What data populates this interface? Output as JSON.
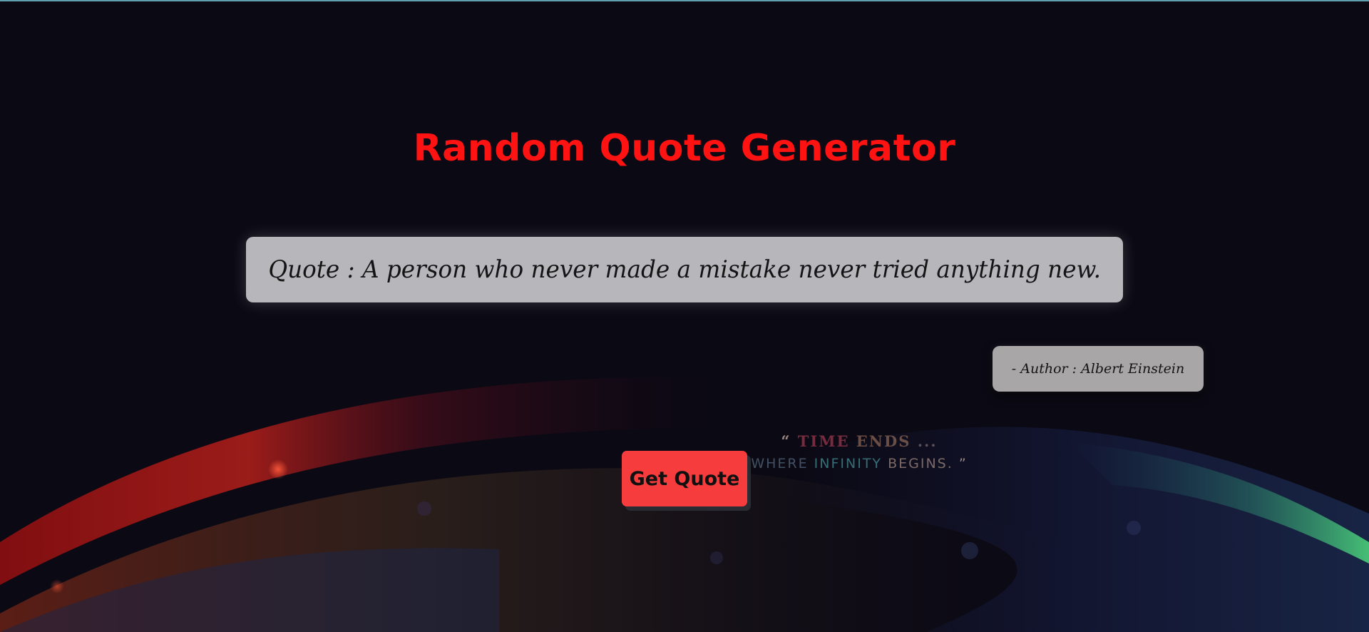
{
  "page": {
    "title": "Random Quote Generator"
  },
  "quote": {
    "text": "Quote : A person who never made a mistake never tried anything new."
  },
  "author": {
    "text": "- Author : Albert Einstein"
  },
  "actions": {
    "get_quote_label": "Get Quote"
  },
  "tagline": {
    "open_quote": "“",
    "word_time": "TIME",
    "word_ends": "ENDS",
    "ellipsis": "...",
    "word_where": "WHERE",
    "word_infinity": "INFINITY",
    "word_begins": "BEGINS.",
    "close_quote": "”"
  },
  "colors": {
    "background": "#0b0913",
    "title": "#ff1212",
    "quote_card": "#b7b7bb",
    "author_card": "#a9a6a8",
    "button": "#f63c3c",
    "wave_red": "#e0251c",
    "wave_green": "#3fbf6a",
    "wave_blue": "#2a3a7a"
  }
}
